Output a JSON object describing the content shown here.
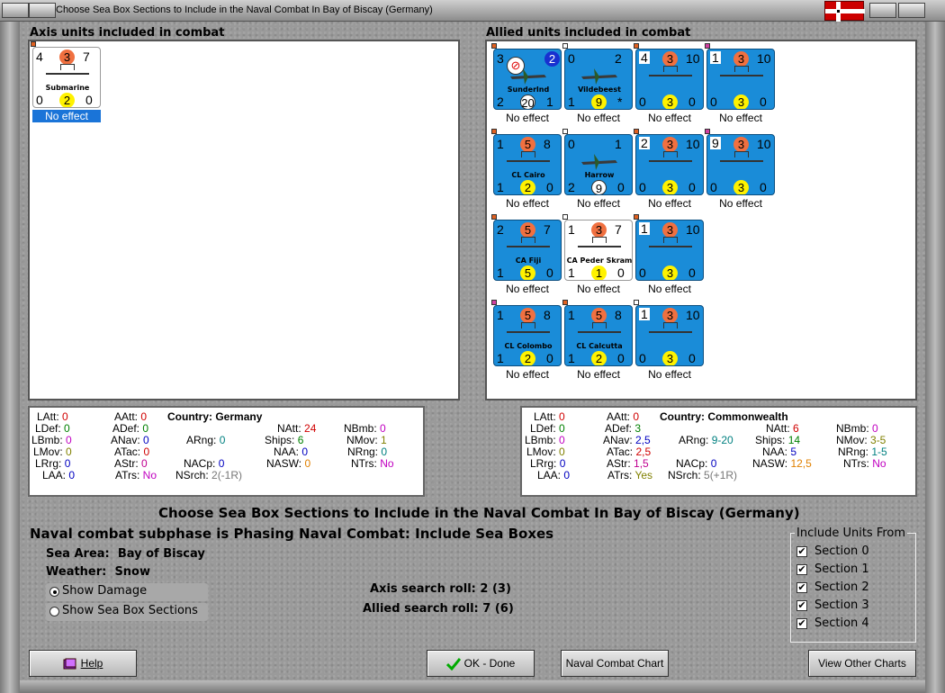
{
  "window": {
    "title": "Choose Sea Box Sections to Include in the Naval Combat In Bay of Biscay (Germany)"
  },
  "axis": {
    "label": "Axis units included in combat",
    "units": [
      {
        "name": "Submarine",
        "tl": "4",
        "tc": "3",
        "tr": "7",
        "bl": "0",
        "bc": "2",
        "br": "0",
        "effect": "No effect"
      }
    ],
    "stats": {
      "country_label": "Country:",
      "country": "Germany",
      "LAtt": "0",
      "LDef": "0",
      "LBmb": "0",
      "LMov": "0",
      "LRrg": "0",
      "LAA": "0",
      "AAtt": "0",
      "ADef": "0",
      "ANav": "0",
      "ATac": "0",
      "AStr": "0",
      "ATrs": "No",
      "ARng": "0",
      "NACp": "0",
      "NAtt": "24",
      "Ships": "6",
      "NAA": "0",
      "NASW": "0",
      "NSrch": "2(-1R)",
      "NBmb": "0",
      "NMov": "1",
      "NRng": "0",
      "NTrs": "No"
    }
  },
  "allied": {
    "label": "Allied units included in combat",
    "units": [
      {
        "name": "Sunderlnd",
        "tl": "3",
        "tc": "",
        "tr": "2",
        "bl": "2",
        "bc": "20",
        "br": "1",
        "effect": "No effect"
      },
      {
        "name": "Vildebeest",
        "tl": "0",
        "tc": "",
        "tr": "2",
        "bl": "1",
        "bc": "9",
        "br": "*",
        "effect": "No effect"
      },
      {
        "name": "",
        "tl": "4",
        "tc": "3",
        "tr": "10",
        "bl": "0",
        "bc": "3",
        "br": "0",
        "effect": "No effect"
      },
      {
        "name": "",
        "tl": "1",
        "tc": "3",
        "tr": "10",
        "bl": "0",
        "bc": "3",
        "br": "0",
        "effect": "No effect"
      },
      {
        "name": "CL Cairo",
        "tl": "1",
        "tc": "5",
        "tr": "8",
        "bl": "1",
        "bc": "2",
        "br": "0",
        "effect": "No effect"
      },
      {
        "name": "Harrow",
        "tl": "0",
        "tc": "",
        "tr": "1",
        "bl": "2",
        "bc": "9",
        "br": "0",
        "effect": "No effect"
      },
      {
        "name": "",
        "tl": "2",
        "tc": "3",
        "tr": "10",
        "bl": "0",
        "bc": "3",
        "br": "0",
        "effect": "No effect"
      },
      {
        "name": "",
        "tl": "9",
        "tc": "3",
        "tr": "10",
        "bl": "0",
        "bc": "3",
        "br": "0",
        "effect": "No effect"
      },
      {
        "name": "CA Fiji",
        "tl": "2",
        "tc": "5",
        "tr": "7",
        "bl": "1",
        "bc": "5",
        "br": "0",
        "effect": "No effect"
      },
      {
        "name": "CA Peder Skram",
        "tl": "1",
        "tc": "3",
        "tr": "7",
        "bl": "1",
        "bc": "1",
        "br": "0",
        "effect": "No effect"
      },
      {
        "name": "",
        "tl": "1",
        "tc": "3",
        "tr": "10",
        "bl": "0",
        "bc": "3",
        "br": "0",
        "effect": "No effect"
      },
      {
        "name": "CL Colombo",
        "tl": "1",
        "tc": "5",
        "tr": "8",
        "bl": "1",
        "bc": "2",
        "br": "0",
        "effect": "No effect"
      },
      {
        "name": "CL Calcutta",
        "tl": "1",
        "tc": "5",
        "tr": "8",
        "bl": "1",
        "bc": "2",
        "br": "0",
        "effect": "No effect"
      },
      {
        "name": "",
        "tl": "1",
        "tc": "3",
        "tr": "10",
        "bl": "0",
        "bc": "3",
        "br": "0",
        "effect": "No effect"
      }
    ],
    "stats": {
      "country_label": "Country:",
      "country": "Commonwealth",
      "LAtt": "0",
      "LDef": "0",
      "LBmb": "0",
      "LMov": "0",
      "LRrg": "0",
      "LAA": "0",
      "AAtt": "0",
      "ADef": "3",
      "ANav": "2,5",
      "ATac": "2,5",
      "AStr": "1,5",
      "ATrs": "Yes",
      "ARng": "9-20",
      "NACp": "0",
      "NAtt": "6",
      "Ships": "14",
      "NAA": "5",
      "NASW": "12,5",
      "NSrch": "5(+1R)",
      "NBmb": "0",
      "NMov": "3-5",
      "NRng": "1-5",
      "NTrs": "No"
    }
  },
  "main": {
    "heading": "Choose Sea Box Sections to Include in the Naval Combat In Bay of Biscay (Germany)",
    "subphase": "Naval combat subphase is Phasing Naval Combat: Include Sea Boxes",
    "sea_area_label": "Sea Area:",
    "sea_area": "Bay of Biscay",
    "weather_label": "Weather:",
    "weather": "Snow",
    "show_damage": "Show Damage",
    "show_sections": "Show Sea Box Sections",
    "axis_search_label": "Axis search roll:",
    "axis_search": "2 (3)",
    "allied_search_label": "Allied search roll:",
    "allied_search": "7 (6)"
  },
  "include": {
    "label": "Include Units From",
    "sections": [
      "Section 0",
      "Section 1",
      "Section 2",
      "Section 3",
      "Section 4"
    ]
  },
  "buttons": {
    "help": "Help",
    "ok": "OK - Done",
    "chart": "Naval Combat Chart",
    "other": "View Other Charts"
  },
  "colors": {
    "unit_blue": "#1a8cd8",
    "selected": "#1a74d8",
    "axis_red": "#f07040",
    "yellow": "#fff200"
  }
}
